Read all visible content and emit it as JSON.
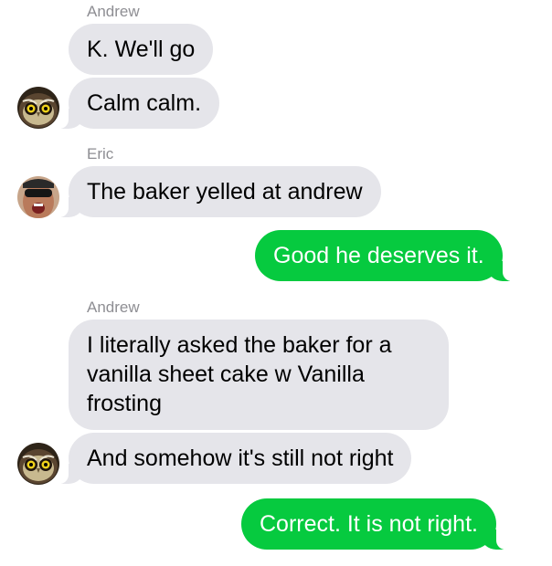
{
  "thread": {
    "messages": [
      {
        "sender": "Andrew",
        "text": "K.  We'll go"
      },
      {
        "text": "Calm calm."
      },
      {
        "sender": "Eric",
        "text": "The baker yelled at andrew"
      },
      {
        "text": "Good he deserves it."
      },
      {
        "sender": "Andrew",
        "text": "I literally asked the baker for a vanilla sheet cake w Vanilla frosting"
      },
      {
        "text": "And somehow it's still not right"
      },
      {
        "text": "Correct. It is not right."
      }
    ]
  },
  "avatars": {
    "andrew": {
      "icon": "owl-avatar"
    },
    "eric": {
      "icon": "person-avatar"
    }
  },
  "colors": {
    "incoming_bubble": "#e5e5ea",
    "outgoing_bubble": "#06ca3f",
    "sender_label": "#8e8e93"
  }
}
